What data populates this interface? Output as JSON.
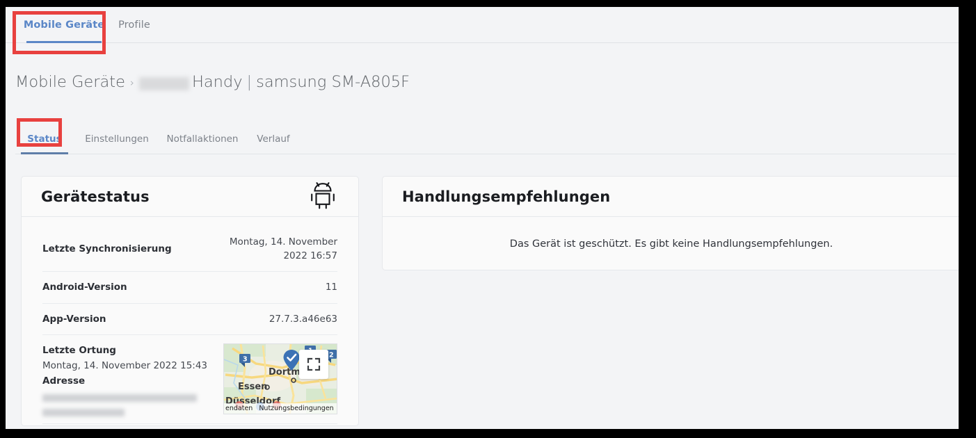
{
  "top_tabs": [
    {
      "label": "Mobile Geräte",
      "active": true
    },
    {
      "label": "Profile",
      "active": false
    }
  ],
  "breadcrumb": {
    "root": "Mobile Geräte",
    "separator": "›",
    "redacted": "",
    "current": "Handy | samsung SM-A805F",
    "device_suffix": "Handy",
    "pipe": "|",
    "device_model": "samsung SM-A805F"
  },
  "sub_tabs": [
    {
      "label": "Status",
      "active": true
    },
    {
      "label": "Einstellungen",
      "active": false
    },
    {
      "label": "Notfallaktionen",
      "active": false
    },
    {
      "label": "Verlauf",
      "active": false
    }
  ],
  "status_card": {
    "title": "Gerätestatus",
    "icon": "android-robot-icon",
    "rows": [
      {
        "key": "Letzte Synchronisierung",
        "value": "Montag, 14. November 2022 16:57"
      },
      {
        "key": "Android-Version",
        "value": "11"
      },
      {
        "key": "App-Version",
        "value": "27.7.3.a46e63"
      }
    ],
    "location": {
      "label": "Letzte Ortung",
      "datetime": "Montag, 14. November 2022 15:43",
      "address_label": "Adresse",
      "address_line_1": "",
      "address_line_2": "",
      "map": {
        "expand_icon": "fullscreen-expand-icon",
        "cities": [
          "Dortm",
          "Essen",
          "Düsseldorf"
        ],
        "markers": [
          "3",
          "1",
          "2"
        ],
        "credit_left": "endaten",
        "credit_right": "Nutzungsbedingungen"
      }
    }
  },
  "recommendations_card": {
    "title": "Handlungsempfehlungen",
    "empty_message": "Das Gerät ist geschützt. Es gibt keine Handlungsempfehlungen."
  },
  "colors": {
    "accent_blue": "#5b87c7",
    "tab_underline": "#5f7ea8",
    "annotation_red": "#e8413f",
    "page_bg": "#f3f4f6",
    "card_bg": "#fafafa",
    "border": "#e6e8eb",
    "text_primary": "#1b1d21",
    "text_muted": "#7d828a"
  }
}
